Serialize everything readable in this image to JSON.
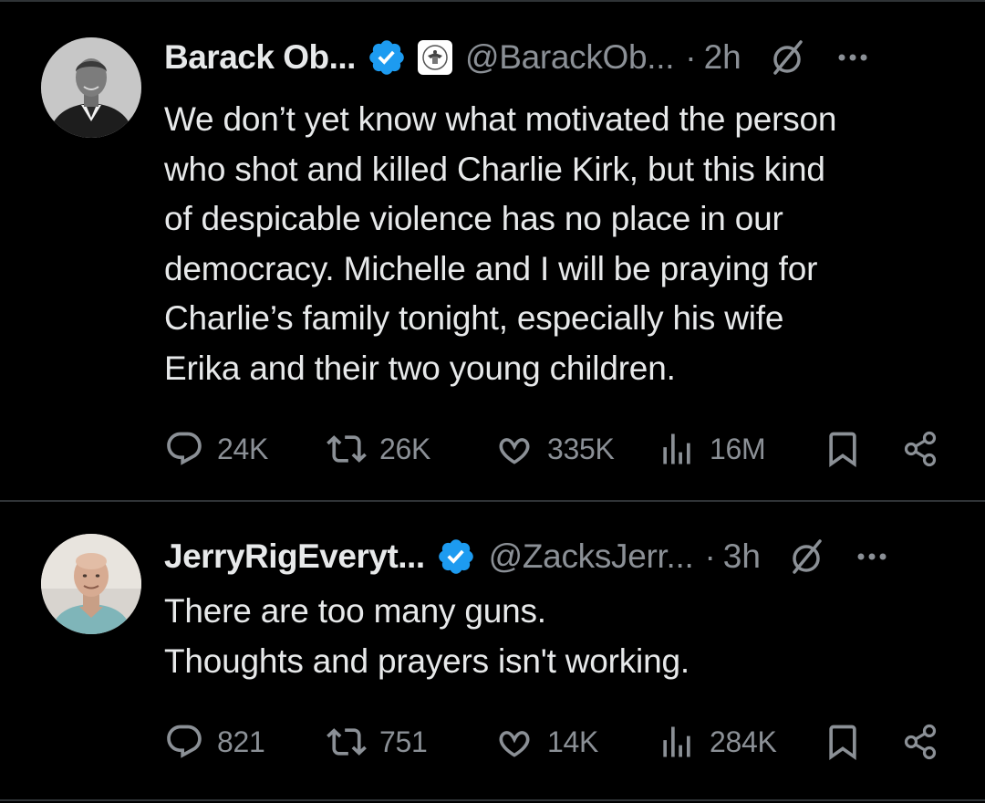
{
  "tweets": [
    {
      "display_name": "Barack Ob...",
      "handle": "@BarackOb...",
      "separator": "·",
      "time": "2h",
      "verified": true,
      "affiliation_badge": "presidential-seal",
      "text_lines": [
        "We don’t yet know what motivated the person",
        "who shot and killed Charlie Kirk, but this kind",
        "of despicable violence has no place in our",
        "democracy. Michelle and I will be praying for",
        "Charlie’s family tonight, especially his wife",
        "Erika and their two young children."
      ],
      "replies": "24K",
      "reposts": "26K",
      "likes": "335K",
      "views": "16M"
    },
    {
      "display_name": "JerryRigEveryt...",
      "handle": "@ZacksJerr...",
      "separator": "·",
      "time": "3h",
      "verified": true,
      "text_lines": [
        "There are too many guns.",
        "Thoughts and prayers isn't working."
      ],
      "replies": "821",
      "reposts": "751",
      "likes": "14K",
      "views": "284K"
    }
  ],
  "icons": {
    "reply": "speech-bubble-icon",
    "repost": "repost-arrows-icon",
    "like": "heart-icon",
    "views": "bar-chart-icon",
    "bookmark": "bookmark-icon",
    "share": "share-icon",
    "grok": "grok-slash-circle-icon",
    "more": "more-dots-icon",
    "verified": "blue-check-badge"
  },
  "colors": {
    "background": "#000000",
    "text": "#e7e9ea",
    "muted": "#8b9096",
    "verified_blue": "#1d9bf0",
    "divider": "#2f3336"
  }
}
